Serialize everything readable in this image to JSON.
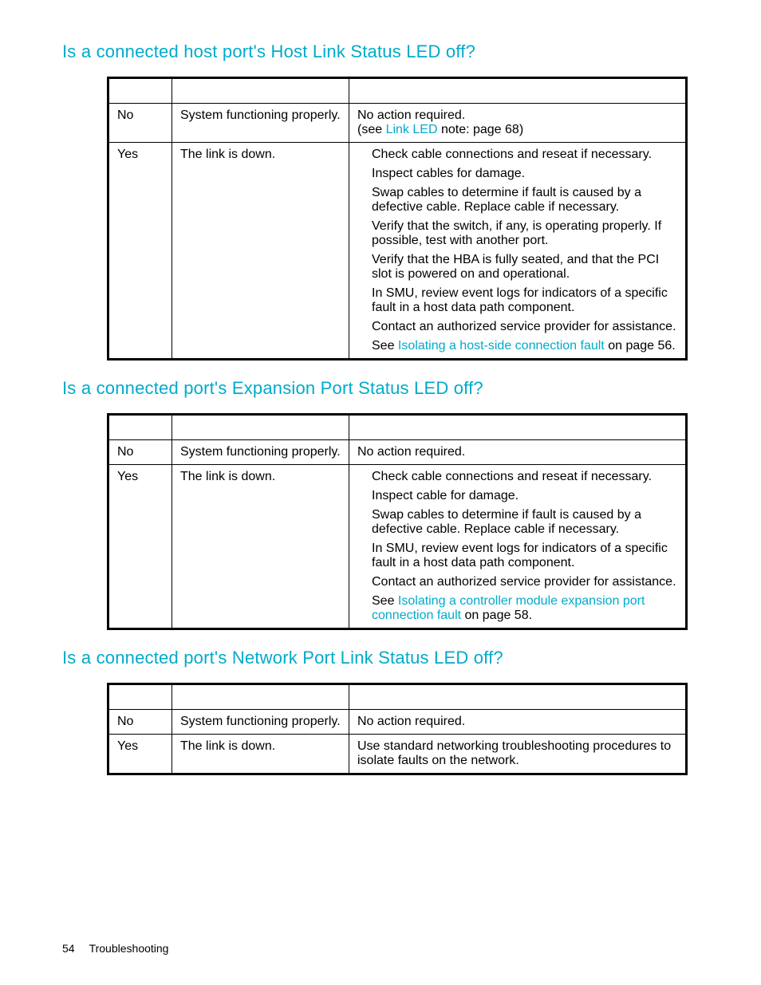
{
  "sections": [
    {
      "heading": "Is a connected host port's Host Link Status LED off?",
      "rows": [
        {
          "answer": "No",
          "status": "System functioning properly.",
          "actions_plain": "No action required.",
          "actions_extra_prefix": "(see ",
          "actions_extra_link": "Link LED",
          "actions_extra_suffix": " note: page 68)"
        },
        {
          "answer": "Yes",
          "status": "The link is down.",
          "actions": [
            "Check cable connections and reseat if necessary.",
            "Inspect cables for damage.",
            "Swap cables to determine if fault is caused by a defective cable. Replace cable if necessary.",
            "Verify that the switch, if any, is operating properly. If possible, test with another port.",
            "Verify that the HBA is fully seated, and that the PCI slot is powered on and operational.",
            "In SMU, review event logs for indicators of a specific fault in a host data path component.",
            "Contact an authorized service provider for assistance."
          ],
          "see_prefix": "See ",
          "see_link": "Isolating a host-side connection fault",
          "see_suffix": " on page 56."
        }
      ]
    },
    {
      "heading": "Is a connected port's Expansion Port Status LED off?",
      "rows": [
        {
          "answer": "No",
          "status": "System functioning properly.",
          "actions_plain": "No action required."
        },
        {
          "answer": "Yes",
          "status": "The link is down.",
          "actions": [
            "Check cable connections and reseat if necessary.",
            "Inspect cable for damage.",
            "Swap cables to determine if fault is caused by a defective cable. Replace cable if necessary.",
            "In SMU, review event logs for indicators of a specific fault in a host data path component.",
            "Contact an authorized service provider for assistance."
          ],
          "see_prefix": "See ",
          "see_link": "Isolating a controller module expansion port connection fault",
          "see_suffix": " on page 58."
        }
      ]
    },
    {
      "heading": "Is a connected port's Network Port Link Status LED off?",
      "rows": [
        {
          "answer": "No",
          "status": "System functioning properly.",
          "actions_plain": "No action required."
        },
        {
          "answer": "Yes",
          "status": "The link is down.",
          "actions_plain": "Use standard networking troubleshooting procedures to isolate faults on the network."
        }
      ]
    }
  ],
  "footer": {
    "page_number": "54",
    "section": "Troubleshooting"
  }
}
